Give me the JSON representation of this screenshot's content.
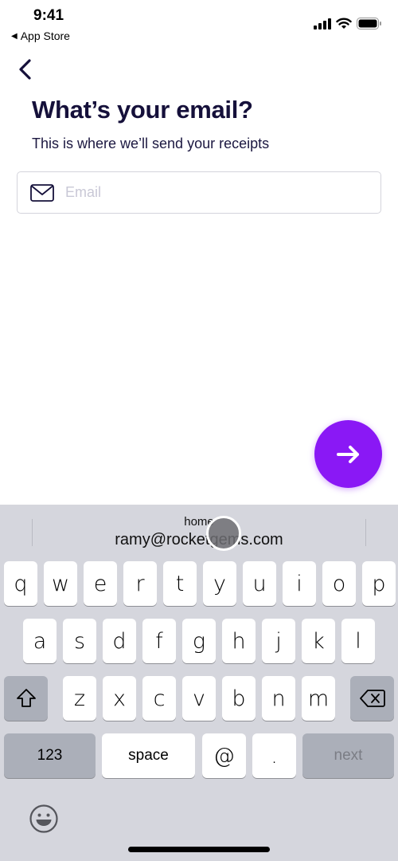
{
  "status_bar": {
    "time": "9:41",
    "back_app_label": "App Store",
    "icons": [
      "cellular-signal-icon",
      "wifi-icon",
      "battery-icon"
    ]
  },
  "nav": {
    "back_icon": "chevron-left-icon"
  },
  "header": {
    "title": "What’s your email?",
    "subtitle": "This is where we’ll send your receipts"
  },
  "email_input": {
    "icon": "envelope-icon",
    "placeholder": "Email",
    "value": ""
  },
  "next_button": {
    "icon": "arrow-right-icon",
    "color": "#8a18f5"
  },
  "keyboard": {
    "suggestion": {
      "label": "home",
      "value": "ramy@rocketgems.com"
    },
    "rows": [
      [
        "q",
        "w",
        "e",
        "r",
        "t",
        "y",
        "u",
        "i",
        "o",
        "p"
      ],
      [
        "a",
        "s",
        "d",
        "f",
        "g",
        "h",
        "j",
        "k",
        "l"
      ],
      [
        "z",
        "x",
        "c",
        "v",
        "b",
        "n",
        "m"
      ]
    ],
    "shift_icon": "shift-icon",
    "delete_icon": "delete-backspace-icon",
    "numbers_label": "123",
    "space_label": "space",
    "at_label": "@",
    "period_label": ".",
    "return_label": "next",
    "emoji_icon": "emoji-icon"
  },
  "colors": {
    "accent": "#8a18f5",
    "title_text": "#15103a",
    "keyboard_bg": "#d5d6dd",
    "function_key": "#abafb9"
  }
}
